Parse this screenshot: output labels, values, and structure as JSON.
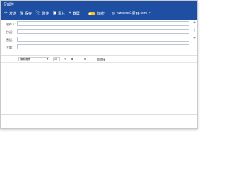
{
  "window": {
    "title": "写邮件"
  },
  "toolbar": {
    "send": "发送",
    "save": "保存",
    "attach": "附件",
    "image": "图片",
    "screenshot": "截屏",
    "encrypt": "加密",
    "account": "hizsxxxx1@qq.com"
  },
  "fields": {
    "to_label": "收件人：",
    "cc_label": "抄送：",
    "bcc_label": "密送：",
    "subject_label": "主题："
  },
  "format": {
    "font": "微软雅黑",
    "size": "10",
    "color_label": "A",
    "bold": "B",
    "italic": "I",
    "underline": "U",
    "signature": "超链接"
  },
  "colors": {
    "topbar": "#1e4fa3",
    "accent": "#3a6bc2",
    "toggle": "#f6c12d"
  }
}
